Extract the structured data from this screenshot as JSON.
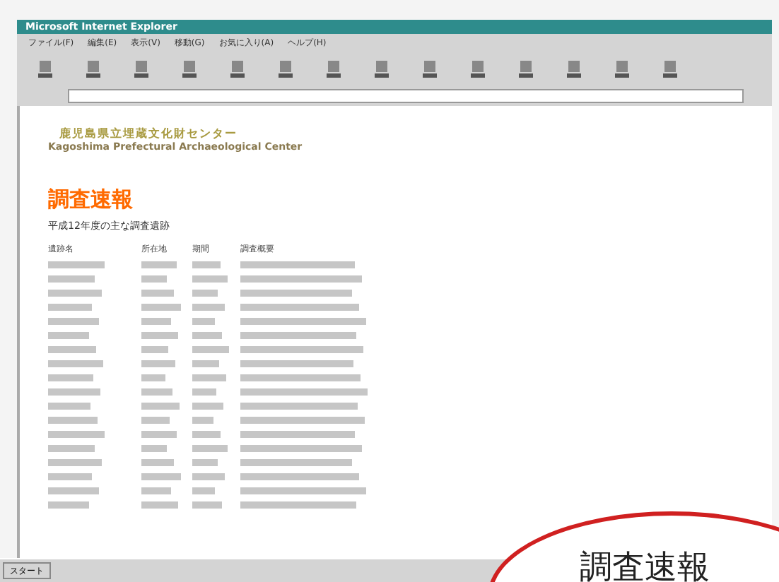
{
  "window": {
    "title": "Microsoft Internet Explorer"
  },
  "menu": [
    "ファイル(F)",
    "編集(E)",
    "表示(V)",
    "移動(G)",
    "お気に入り(A)",
    "ヘルプ(H)"
  ],
  "logo": {
    "name_ja": "鹿児島県立埋蔵文化財センター",
    "name_en": "Kagoshima Prefectural Archaeological Center"
  },
  "heading": "調査速報",
  "subtitle": "平成12年度の主な調査遺跡",
  "table": {
    "columns": [
      "遺跡名",
      "所在地",
      "期間",
      "調査概要"
    ],
    "rows": [
      {
        "kind": "illegible"
      },
      {
        "kind": "illegible"
      },
      {
        "kind": "illegible"
      },
      {
        "kind": "illegible"
      },
      {
        "kind": "illegible"
      },
      {
        "kind": "illegible"
      },
      {
        "kind": "illegible"
      },
      {
        "kind": "illegible"
      },
      {
        "kind": "illegible"
      },
      {
        "kind": "illegible"
      },
      {
        "kind": "illegible"
      },
      {
        "kind": "illegible"
      },
      {
        "kind": "illegible"
      },
      {
        "kind": "illegible"
      },
      {
        "kind": "illegible"
      },
      {
        "kind": "illegible"
      },
      {
        "kind": "illegible"
      },
      {
        "kind": "illegible"
      }
    ]
  },
  "taskbar": {
    "start": "スタート"
  },
  "callout": "調査速報"
}
